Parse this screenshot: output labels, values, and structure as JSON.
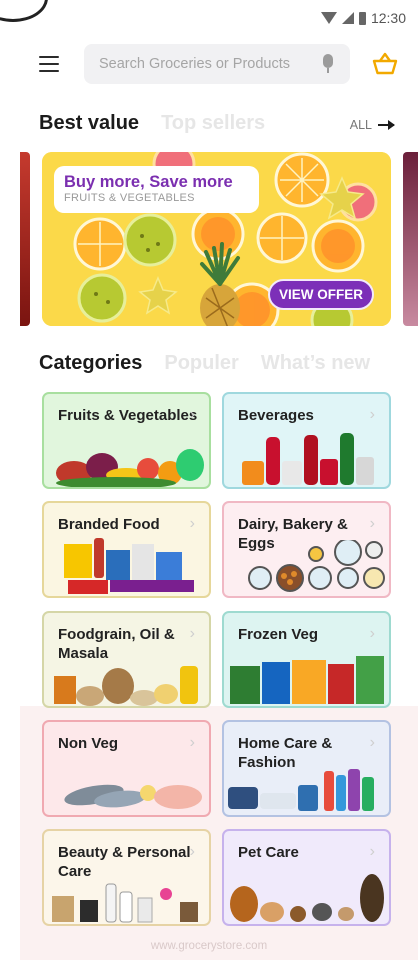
{
  "status": {
    "time": "12:30"
  },
  "header": {
    "search_placeholder": "Search Groceries or Products"
  },
  "best": {
    "active": "Best value",
    "inactive": "Top sellers",
    "all": "ALL"
  },
  "banner": {
    "headline": "Buy more, Save more",
    "subline": "FRUITS & VEGETABLES",
    "cta": "VIEW OFFER"
  },
  "cat_tabs": {
    "active": "Categories",
    "second": "Populer",
    "third": "What’s new"
  },
  "categories": [
    {
      "label": "Fruits & Vegetables",
      "bg": "#e1f6dd",
      "border": "#a8df9f"
    },
    {
      "label": "Beverages",
      "bg": "#e0f5f7",
      "border": "#9fd8de"
    },
    {
      "label": "Branded Food",
      "bg": "#fbf6e2",
      "border": "#e6d79a"
    },
    {
      "label": "Dairy, Bakery & Eggs",
      "bg": "#fdeef1",
      "border": "#f0b8c4"
    },
    {
      "label": "Foodgrain, Oil & Masala",
      "bg": "#f5f5e4",
      "border": "#d5d6a7"
    },
    {
      "label": "Frozen Veg",
      "bg": "#ddf4f1",
      "border": "#9edad0"
    },
    {
      "label": "Non Veg",
      "bg": "#fde8ea",
      "border": "#f0a9b1"
    },
    {
      "label": "Home Care & Fashion",
      "bg": "#e9eef8",
      "border": "#b3c2e2"
    },
    {
      "label": "Beauty & Personal Care",
      "bg": "#fcf6ea",
      "border": "#e6d3a5"
    },
    {
      "label": "Pet Care",
      "bg": "#f0eafb",
      "border": "#c6b2ec"
    }
  ],
  "footer": "www.grocerystore.com",
  "icons": {
    "menu": "hamburger-icon",
    "search_mic": "mic-icon",
    "cart": "basket-icon",
    "arrow": "arrow-right-icon",
    "chevron": "chevron-right-icon"
  },
  "colors": {
    "accent": "#7b2fb0",
    "banner_bg": "#fbd949",
    "basket": "#f2a900"
  }
}
